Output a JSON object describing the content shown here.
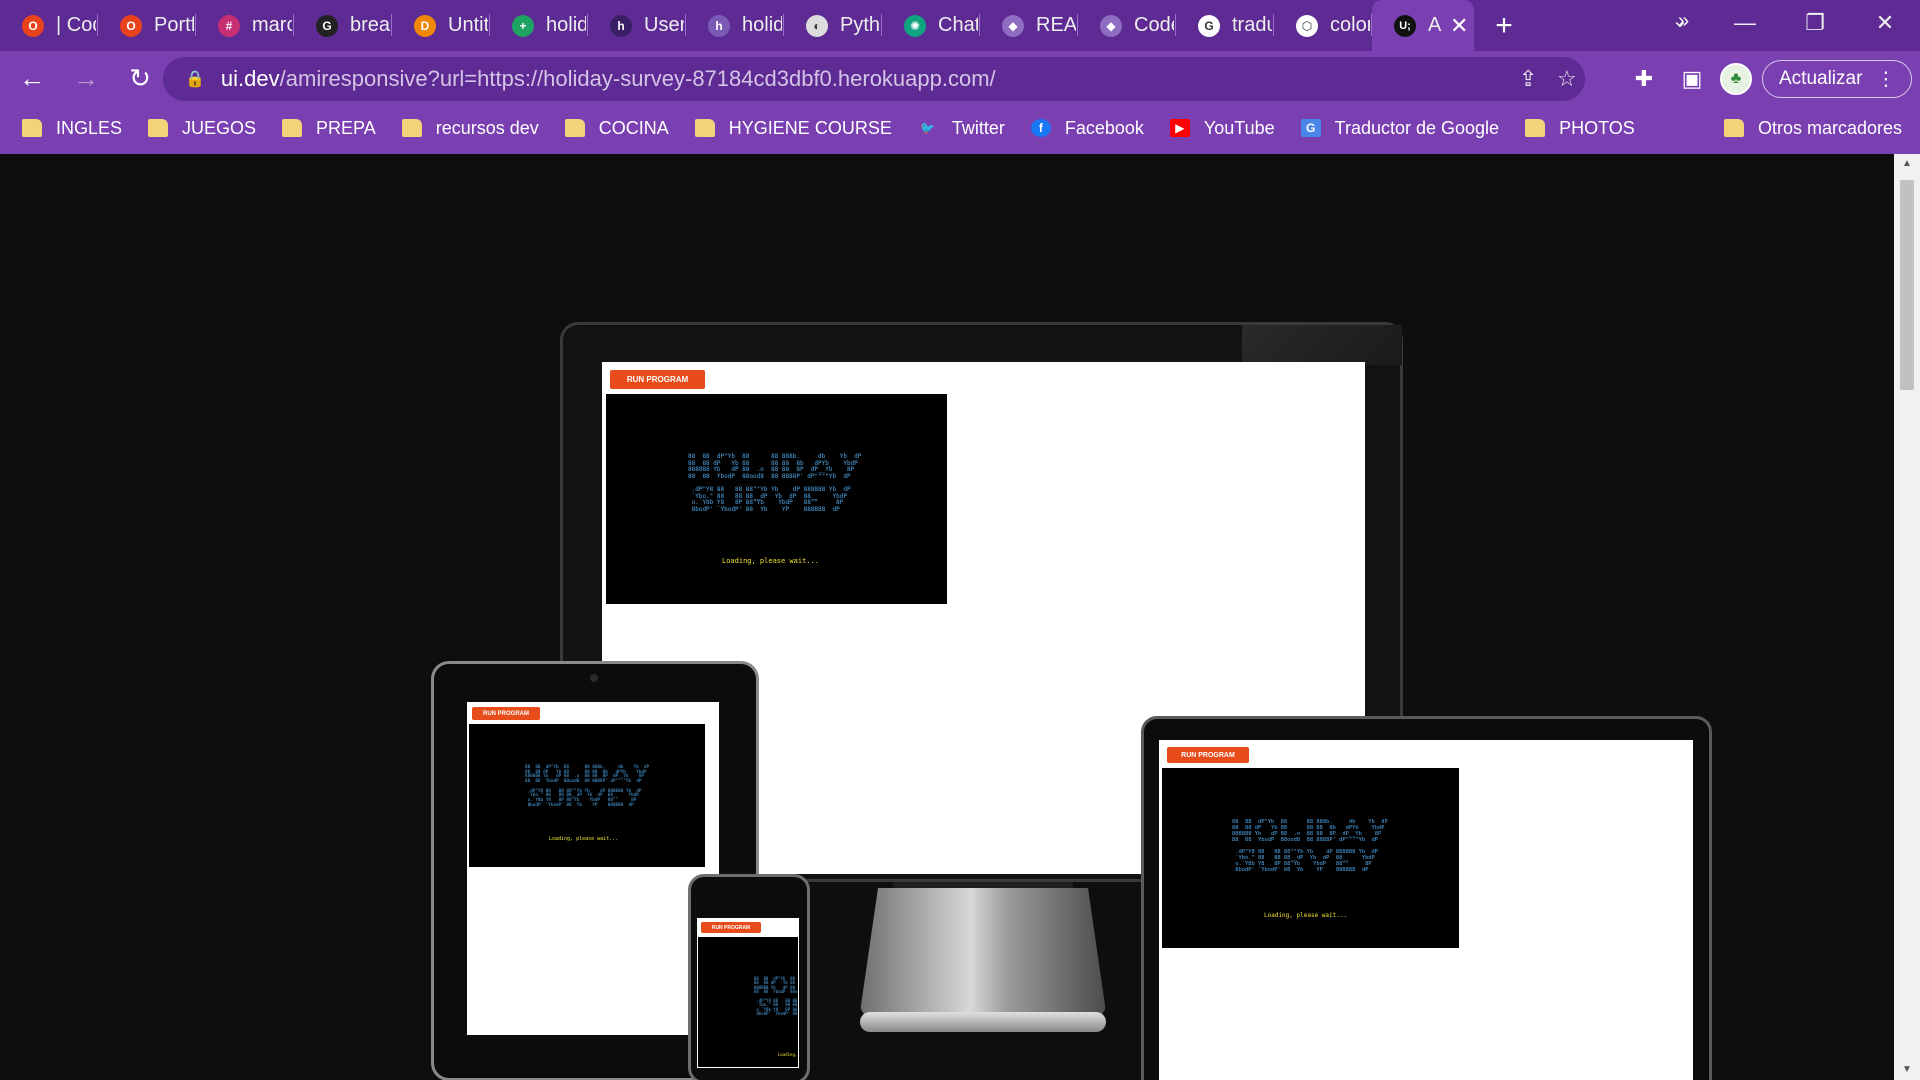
{
  "tabs": [
    {
      "title": "| Cod",
      "icon": "opera-icon",
      "color": "#e8431c",
      "glyph": "O"
    },
    {
      "title": "Portfo",
      "icon": "opera-icon",
      "color": "#e8431c",
      "glyph": "O"
    },
    {
      "title": "marc",
      "icon": "slack-icon",
      "color": "#c72e73",
      "glyph": "#"
    },
    {
      "title": "break",
      "icon": "github-icon",
      "color": "#222222",
      "glyph": "G"
    },
    {
      "title": "Untit",
      "icon": "diagram-icon",
      "color": "#f08705",
      "glyph": "D"
    },
    {
      "title": "holid",
      "icon": "sheets-icon",
      "color": "#1ea362",
      "glyph": "+"
    },
    {
      "title": "User",
      "icon": "heroku-icon",
      "color": "#3a1f66",
      "glyph": "h"
    },
    {
      "title": "holid",
      "icon": "heroku-icon",
      "color": "#7b5ab5",
      "glyph": "h"
    },
    {
      "title": "Pytho",
      "icon": "globe-icon",
      "color": "#dddddd",
      "glyph": "◐"
    },
    {
      "title": "Chat",
      "icon": "chatgpt-icon",
      "color": "#10a37f",
      "glyph": "✺"
    },
    {
      "title": "READ",
      "icon": "cube-icon",
      "color": "#8e6cc2",
      "glyph": "◆"
    },
    {
      "title": "Code",
      "icon": "cube-icon",
      "color": "#8e6cc2",
      "glyph": "◆"
    },
    {
      "title": "tradu",
      "icon": "google-icon",
      "color": "#ffffff",
      "glyph": "G"
    },
    {
      "title": "color",
      "icon": "cube-icon",
      "color": "#ffffff",
      "glyph": "⬡"
    }
  ],
  "active_tab": {
    "title": "A",
    "glyph": "U;"
  },
  "address": {
    "host": "ui.dev",
    "path": "/amiresponsive?url=https://holiday-survey-87184cd3dbf0.herokuapp.com/"
  },
  "toolbar": {
    "update_label": "Actualizar"
  },
  "bookmarks": [
    {
      "label": "INGLES",
      "type": "folder"
    },
    {
      "label": "JUEGOS",
      "type": "folder"
    },
    {
      "label": "PREPA",
      "type": "folder"
    },
    {
      "label": "recursos dev",
      "type": "folder"
    },
    {
      "label": "COCINA",
      "type": "folder"
    },
    {
      "label": "HYGIENE COURSE",
      "type": "folder"
    },
    {
      "label": "Twitter",
      "type": "twitter"
    },
    {
      "label": "Facebook",
      "type": "facebook"
    },
    {
      "label": "YouTube",
      "type": "youtube"
    },
    {
      "label": "Traductor de Google",
      "type": "translate"
    },
    {
      "label": "PHOTOS",
      "type": "folder"
    }
  ],
  "bookmarks_more": "»",
  "other_bookmarks": "Otros marcadores",
  "app": {
    "run_button": "RUN PROGRAM",
    "loading_text": "Loading, please wait...",
    "ascii_art": "88  88  dP\"Yb  88      88 888b.     db    Yb  dP\n88  88 dP   Yb 88      88 88  8b   dPYb    YbdP \n888888 Yb   dP 88  .o  88 88  8P  dP__Yb    8P  \n88  88  YbodP  88ood8  88 8888P' dP\"\"\"\"Yb  dP   \n\n .dP\"Y8 88   88 88\"\"Yb Yb    dP 888888 Yb  dP\n `Ybo.\" 88   88 88__dP  Yb  dP  88__    YbdP \n o.`Y8b Y8   8P 88\"Yb    YbdP   88\"\"     8P  \n 8bodP' `YbodP' 88  Yb    YP    888888  dP   "
  },
  "colors": {
    "chrome_purple": "#7a3fb0",
    "tab_strip": "#5e2a93",
    "run_button": "#e84c1b",
    "ascii_blue": "#4fa7e8",
    "loading_yellow": "#f2e233"
  }
}
